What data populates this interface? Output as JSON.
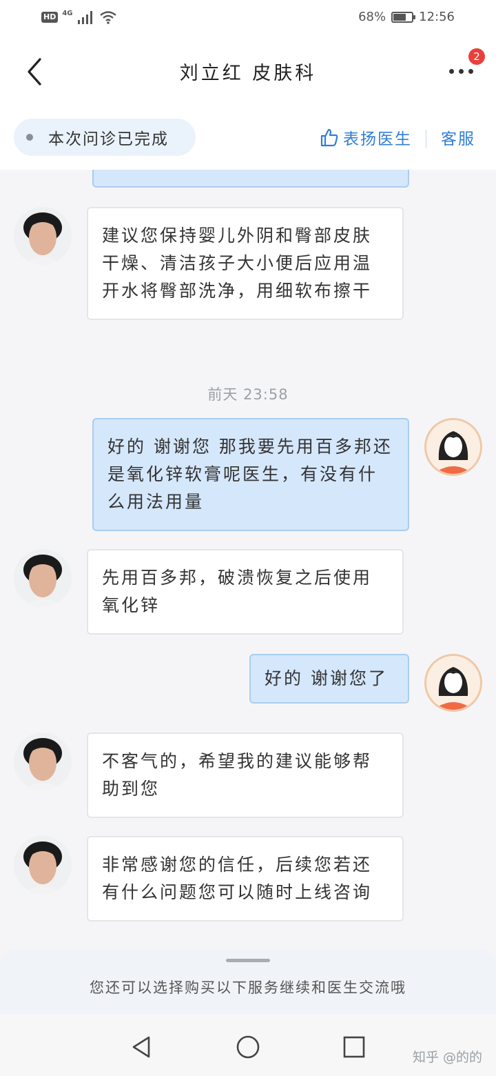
{
  "status_bar": {
    "hd_label": "HD",
    "network_label": "4G",
    "battery_percent_text": "68%",
    "battery_level": 0.68,
    "time": "12:56"
  },
  "header": {
    "title": "刘立红 皮肤科",
    "back_icon": "chevron-left-icon",
    "more_icon": "more-dots-icon",
    "more_badge_count": "2",
    "badge_color": "#e8413c"
  },
  "info_strip": {
    "status_text": "本次问诊已完成",
    "praise_label": "表扬医生",
    "service_label": "客服",
    "accent_color": "#2f7ed8"
  },
  "chat": {
    "timestamp": "前天 23:58",
    "messages": [
      {
        "sender": "doctor",
        "text": "建议您保持婴儿外阴和臀部皮肤干燥、清洁孩子大小便后应用温开水将臀部洗净，用细软布擦干"
      },
      {
        "sender": "patient",
        "text": "好的 谢谢您 那我要先用百多邦还是氧化锌软膏呢医生，有没有什么用法用量"
      },
      {
        "sender": "doctor",
        "text": "先用百多邦，破溃恢复之后使用氧化锌"
      },
      {
        "sender": "patient",
        "text": "好的 谢谢您了"
      },
      {
        "sender": "doctor",
        "text": "不客气的，希望我的建议能够帮助到您"
      },
      {
        "sender": "doctor",
        "text": "非常感谢您的信任，后续您若还有什么问题您可以随时上线咨询"
      }
    ]
  },
  "bottom_sheet": {
    "text": "您还可以选择购买以下服务继续和医生交流哦"
  },
  "system_nav": {
    "back_icon": "triangle-back-icon",
    "home_icon": "circle-home-icon",
    "recents_icon": "square-recents-icon",
    "watermark": "知乎 @的的"
  }
}
